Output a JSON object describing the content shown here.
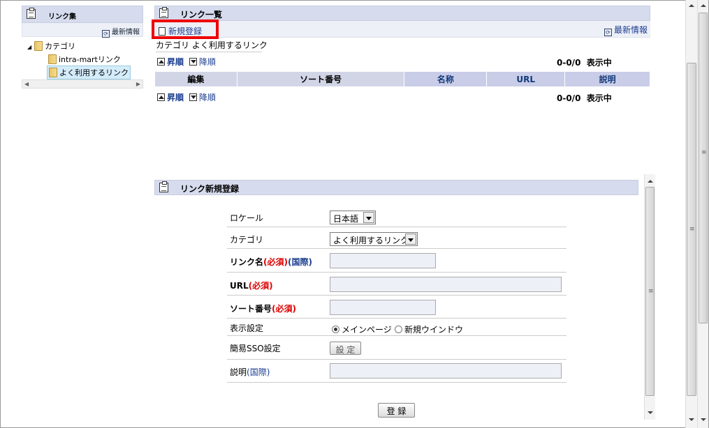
{
  "left_pane": {
    "title": "リンク集",
    "refresh_label": "最新情報",
    "tree": {
      "root": "カテゴリ",
      "items": [
        "intra-martリンク",
        "よく利用するリンク"
      ]
    }
  },
  "list_pane": {
    "title": "リンク一覧",
    "new_button": "新規登録",
    "refresh_label": "最新情報",
    "category_label": "カテゴリ",
    "category_value": "よく利用するリンク",
    "sort_asc": "昇順",
    "sort_desc": "降順",
    "count_text": "0-0/0",
    "display_text": "表示中",
    "columns": [
      "編集",
      "ソート番号",
      "名称",
      "URL",
      "説明"
    ]
  },
  "form_pane": {
    "title": "リンク新規登録",
    "locale_label": "ロケール",
    "locale_value": "日本語",
    "category_label": "カテゴリ",
    "category_value": "よく利用するリンク",
    "link_name_label": "リンク名",
    "required_mark": "(必須)",
    "intl_mark": "(国際)",
    "url_label": "URL",
    "sort_label": "ソート番号",
    "display_label": "表示設定",
    "display_opt_main": "メインページ",
    "display_opt_new": "新規ウインドウ",
    "sso_label": "簡易SSO設定",
    "sso_button": "設 定",
    "desc_label": "説明",
    "submit_button": "登 録"
  }
}
